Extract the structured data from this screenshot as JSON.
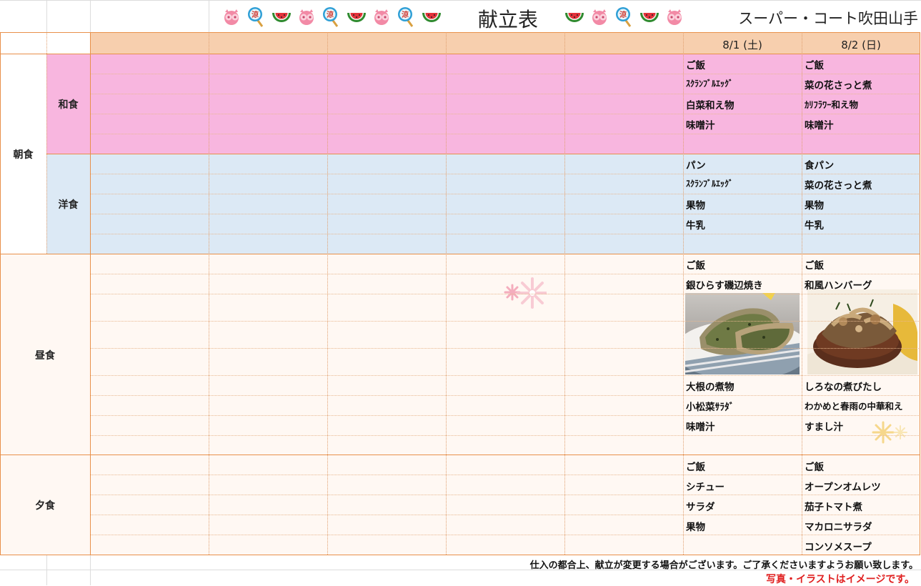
{
  "header": {
    "title": "献立表",
    "store": "スーパー・コート吹田山手",
    "deco_left": [
      "pig-icon",
      "uchiwa-icon",
      "watermelon-icon",
      "pig-icon",
      "uchiwa-icon",
      "watermelon-icon",
      "pig-icon",
      "uchiwa-icon",
      "watermelon-icon"
    ],
    "deco_right": [
      "watermelon-icon",
      "pig-icon",
      "uchiwa-icon",
      "watermelon-icon",
      "pig-icon"
    ],
    "uchiwa_char": "涼"
  },
  "dates": [
    "8/1 (土)",
    "8/2 (日)"
  ],
  "meals": {
    "breakfast": "朝食",
    "japanese": "和食",
    "western": "洋食",
    "lunch": "昼食",
    "dinner": "夕食"
  },
  "menu": {
    "japanese": [
      [
        "ご飯",
        "ご飯"
      ],
      [
        "ｽｸﾗﾝﾌﾞﾙｴｯｸﾞ",
        "菜の花さっと煮"
      ],
      [
        "白菜和え物",
        "ｶﾘﾌﾗﾜｰ和え物"
      ],
      [
        "味噌汁",
        "味噌汁"
      ]
    ],
    "western": [
      [
        "パン",
        "食パン"
      ],
      [
        "ｽｸﾗﾝﾌﾞﾙｴｯｸﾞ",
        "菜の花さっと煮"
      ],
      [
        "果物",
        "果物"
      ],
      [
        "牛乳",
        "牛乳"
      ]
    ],
    "lunch_top": [
      [
        "ご飯",
        "ご飯"
      ],
      [
        "銀ひらす磯辺焼き",
        "和風ハンバーグ"
      ]
    ],
    "lunch_bottom": [
      [
        "大根の煮物",
        "しろなの煮びたし"
      ],
      [
        "小松菜ｻﾗﾀﾞ",
        "わかめと春雨の中華和え"
      ],
      [
        "味噌汁",
        "すまし汁"
      ]
    ],
    "dinner": [
      [
        "ご飯",
        "ご飯"
      ],
      [
        "シチュー",
        "オープンオムレツ"
      ],
      [
        "サラダ",
        "茄子トマト煮"
      ],
      [
        "果物",
        "マカロニサラダ"
      ],
      [
        "",
        "コンソメスープ"
      ]
    ]
  },
  "footer": {
    "notice": "仕入の都合上、献立が変更する場合がございます。ご了承くださいますようお願い致します。",
    "image_note": "写真・イラストはイメージです。"
  },
  "colors": {
    "header_row": "#f7cfae",
    "japanese_bg": "#f8b6df",
    "western_bg": "#dce9f5",
    "border": "#e8904a",
    "note_red": "#e02020"
  }
}
